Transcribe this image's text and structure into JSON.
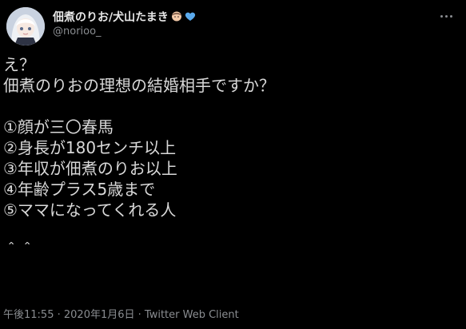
{
  "author": {
    "display_name": "佃煮のりお/犬山たまき",
    "handle": "@norioo_",
    "emoji": [
      "girl-face-emoji",
      "blue-heart-emoji"
    ],
    "heart_color": "#5aa9ec"
  },
  "tweet": {
    "lines": [
      "え？",
      "佃煮のりおの理想の結婚相手ですか？",
      "",
      "①顔が三〇春馬",
      "②身長が180センチ以上",
      "③年収が佃煮のりお以上",
      "④年齢プラス5歳まで",
      "⑤ママになってくれる人",
      "",
      "＾＾"
    ]
  },
  "meta": {
    "time": "午後11:55",
    "separator1": " · ",
    "date": "2020年1月6日",
    "separator2": " · ",
    "client": "Twitter Web Client"
  },
  "icons": {
    "more": "more-horizontal-icon"
  }
}
